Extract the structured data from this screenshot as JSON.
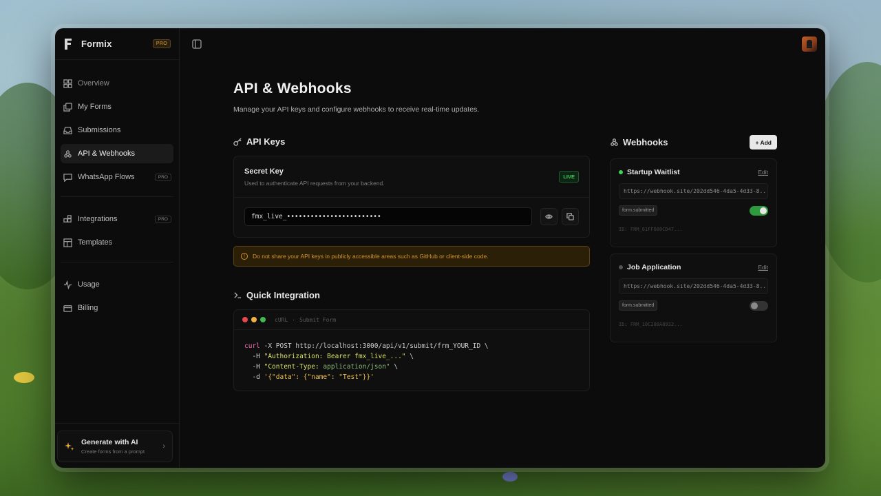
{
  "brand": {
    "name": "Formix",
    "badge": "PRO"
  },
  "sidebar": {
    "items": [
      {
        "label": "Overview",
        "icon": "grid-icon"
      },
      {
        "label": "My Forms",
        "icon": "copy-icon"
      },
      {
        "label": "Submissions",
        "icon": "inbox-icon"
      },
      {
        "label": "API & Webhooks",
        "icon": "webhook-icon",
        "active": true
      },
      {
        "label": "WhatsApp Flows",
        "icon": "message-icon",
        "tag": "PRO"
      },
      {
        "label": "Integrations",
        "icon": "blocks-icon",
        "tag": "PRO"
      },
      {
        "label": "Templates",
        "icon": "layout-icon"
      },
      {
        "label": "Usage",
        "icon": "activity-icon"
      },
      {
        "label": "Billing",
        "icon": "card-icon"
      }
    ],
    "generate": {
      "title": "Generate with AI",
      "subtitle": "Create forms from a prompt"
    }
  },
  "page": {
    "title": "API & Webhooks",
    "subtitle": "Manage your API keys and configure webhooks to receive real-time updates."
  },
  "api_keys": {
    "title": "API Keys",
    "secret": {
      "title": "Secret Key",
      "description": "Used to authenticate API requests from your backend.",
      "badge": "LIVE",
      "value": "fmx_live_••••••••••••••••••••••••"
    },
    "warning": "Do not share your API keys in publicly accessible areas such as GitHub or client-side code."
  },
  "integration": {
    "title": "Quick Integration",
    "lang": "cURL",
    "label": "Submit Form",
    "lines": {
      "l1_cmd": "curl",
      "l1_rest": " -X POST http://localhost:3000/api/v1/submit/frm_YOUR_ID \\",
      "l2_flag": "  -H ",
      "l2_key": "\"Authorization: ",
      "l2_val": "Bearer fmx_live_...\"",
      "l2_end": " \\",
      "l3_flag": "  -H ",
      "l3_key": "\"Content-Type: ",
      "l3_val": "application/json\"",
      "l3_end": " \\",
      "l4_flag": "  -d ",
      "l4_body": "'{\"data\": {\"name\": \"Test\"}}'"
    }
  },
  "webhooks": {
    "title": "Webhooks",
    "add_label": "+ Add",
    "items": [
      {
        "name": "Startup Waitlist",
        "edit": "Edit",
        "url": "https://webhook.site/202dd546-4da5-4d33-8...",
        "event": "form.submitted",
        "enabled": true,
        "id": "ID: FRM_61FF680CD47..."
      },
      {
        "name": "Job Application",
        "edit": "Edit",
        "url": "https://webhook.site/202dd546-4da5-4d33-8...",
        "event": "form.submitted",
        "enabled": false,
        "id": "ID: FRM_10C288A8932..."
      }
    ]
  },
  "colors": {
    "accent_live": "#3fcf5a",
    "warning": "#d6952e",
    "pro": "#e8a23a"
  }
}
